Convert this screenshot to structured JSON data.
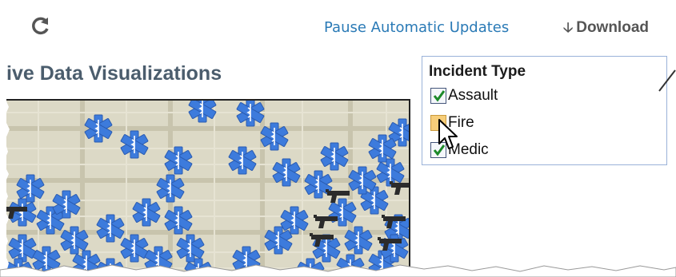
{
  "toolbar": {
    "refresh_icon": "refresh-icon",
    "pause_label": "Pause Automatic Updates",
    "download_icon": "download-arrow-icon",
    "download_label": "Download",
    "link_color": "#2a7ab6"
  },
  "panel": {
    "title": "ive Data Visualizations"
  },
  "map": {
    "marker_types": [
      "medic-star-of-life",
      "assault-gun"
    ],
    "medic_color": "#3d7bdc",
    "assault_color": "#2b2b2b",
    "background_color": "#dcd9c6"
  },
  "legend": {
    "title": "Incident Type",
    "items": [
      {
        "label": "Assault",
        "checked": true
      },
      {
        "label": "Fire",
        "checked": false,
        "hovered": true
      },
      {
        "label": "Medic",
        "checked": true
      }
    ],
    "border_color": "#9ab2d9"
  }
}
